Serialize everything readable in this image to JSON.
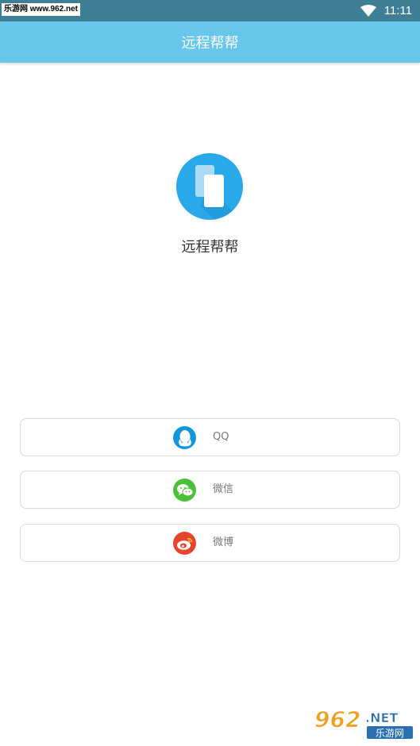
{
  "status_bar": {
    "watermark": "乐游网 www.962.net",
    "time": "11:11",
    "icons": [
      "wifi-icon"
    ]
  },
  "app_bar": {
    "title": "远程帮帮"
  },
  "main": {
    "app_name": "远程帮帮",
    "logo_icon": "phone-copy-icon"
  },
  "login_options": [
    {
      "label": "QQ",
      "icon": "qq-icon",
      "color": "#1296db"
    },
    {
      "label": "微信",
      "icon": "wechat-icon",
      "color": "#4cbf3a"
    },
    {
      "label": "微博",
      "icon": "weibo-icon",
      "color": "#e6442e"
    }
  ],
  "watermark_bottom": {
    "line1": "962.NET",
    "line2": "乐游网"
  },
  "colors": {
    "status_bar": "#3f7f95",
    "app_bar": "#67c6ea",
    "logo": "#29a9ea"
  }
}
